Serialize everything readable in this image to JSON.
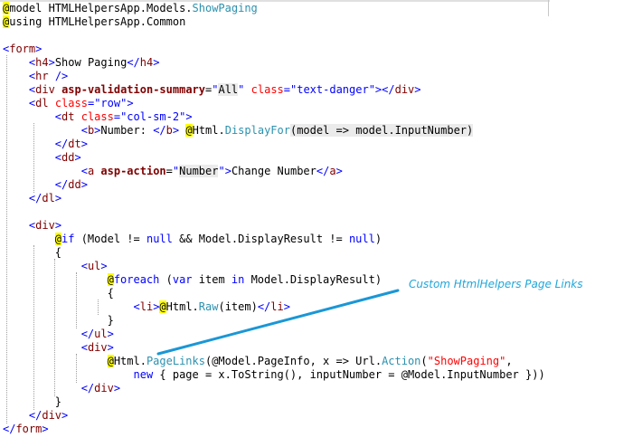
{
  "colors": {
    "keyword_blue": "#0000ff",
    "tag_maroon": "#800000",
    "attr_red": "#ff0000",
    "type_teal": "#2b91af",
    "razor_highlight": "#ffff00",
    "annotation_blue": "#21a6d9"
  },
  "annotation": {
    "text": "Custom HtmlHelpers Page Links"
  },
  "code": [
    [
      [
        "@",
        "hl"
      ],
      [
        "model",
        ""
      ],
      [
        " HTMLHelpersApp.Models.",
        ""
      ],
      [
        "ShowPaging",
        "type"
      ]
    ],
    [
      [
        "@",
        "hl"
      ],
      [
        "using",
        ""
      ],
      [
        " HTMLHelpersApp.Common",
        ""
      ]
    ],
    [],
    [
      [
        "<",
        "kw"
      ],
      [
        "form",
        "tag"
      ],
      [
        ">",
        "kw"
      ]
    ],
    [
      [
        "    ",
        ""
      ],
      [
        "<",
        "kw"
      ],
      [
        "h4",
        "tag"
      ],
      [
        ">",
        "kw"
      ],
      [
        "Show Paging",
        ""
      ],
      [
        "</",
        "kw"
      ],
      [
        "h4",
        "tag"
      ],
      [
        ">",
        "kw"
      ]
    ],
    [
      [
        "    ",
        ""
      ],
      [
        "<",
        "kw"
      ],
      [
        "hr",
        "tag"
      ],
      [
        " />",
        "kw"
      ]
    ],
    [
      [
        "    ",
        ""
      ],
      [
        "<",
        "kw"
      ],
      [
        "div",
        "tag"
      ],
      [
        " ",
        ""
      ],
      [
        "asp-validation-summary",
        "bold"
      ],
      [
        "=",
        ""
      ],
      [
        "\"",
        "kw"
      ],
      [
        "All",
        "bgGray"
      ],
      [
        "\"",
        "kw"
      ],
      [
        " ",
        ""
      ],
      [
        "class",
        "attr"
      ],
      [
        "=",
        "kw"
      ],
      [
        "\"text-danger\"",
        "kw"
      ],
      [
        "></",
        "kw"
      ],
      [
        "div",
        "tag"
      ],
      [
        ">",
        "kw"
      ]
    ],
    [
      [
        "    ",
        ""
      ],
      [
        "<",
        "kw"
      ],
      [
        "dl",
        "tag"
      ],
      [
        " ",
        ""
      ],
      [
        "class",
        "attr"
      ],
      [
        "=",
        "kw"
      ],
      [
        "\"row\"",
        "kw"
      ],
      [
        ">",
        "kw"
      ]
    ],
    [
      [
        "        ",
        ""
      ],
      [
        "<",
        "kw"
      ],
      [
        "dt",
        "tag"
      ],
      [
        " ",
        ""
      ],
      [
        "class",
        "attr"
      ],
      [
        "=",
        "kw"
      ],
      [
        "\"col-sm-2\"",
        "kw"
      ],
      [
        ">",
        "kw"
      ]
    ],
    [
      [
        "            ",
        ""
      ],
      [
        "<",
        "kw"
      ],
      [
        "b",
        "tag"
      ],
      [
        ">",
        "kw"
      ],
      [
        "Number: ",
        ""
      ],
      [
        "</",
        "kw"
      ],
      [
        "b",
        "tag"
      ],
      [
        ">",
        "kw"
      ],
      [
        " ",
        ""
      ],
      [
        "@",
        "hl"
      ],
      [
        "Html.",
        ""
      ],
      [
        "DisplayFor",
        "type"
      ],
      [
        "(model => model.InputNumber)",
        "bgGray"
      ]
    ],
    [
      [
        "        ",
        ""
      ],
      [
        "</",
        "kw"
      ],
      [
        "dt",
        "tag"
      ],
      [
        ">",
        "kw"
      ]
    ],
    [
      [
        "        ",
        ""
      ],
      [
        "<",
        "kw"
      ],
      [
        "dd",
        "tag"
      ],
      [
        ">",
        "kw"
      ]
    ],
    [
      [
        "            ",
        ""
      ],
      [
        "<",
        "kw"
      ],
      [
        "a",
        "tag"
      ],
      [
        " ",
        ""
      ],
      [
        "asp-action",
        "bold"
      ],
      [
        "=",
        ""
      ],
      [
        "\"",
        "kw"
      ],
      [
        "Number",
        "bgGray"
      ],
      [
        "\"",
        "kw"
      ],
      [
        ">",
        "kw"
      ],
      [
        "Change Number",
        ""
      ],
      [
        "</",
        "kw"
      ],
      [
        "a",
        "tag"
      ],
      [
        ">",
        "kw"
      ]
    ],
    [
      [
        "        ",
        ""
      ],
      [
        "</",
        "kw"
      ],
      [
        "dd",
        "tag"
      ],
      [
        ">",
        "kw"
      ]
    ],
    [
      [
        "    ",
        ""
      ],
      [
        "</",
        "kw"
      ],
      [
        "dl",
        "tag"
      ],
      [
        ">",
        "kw"
      ]
    ],
    [],
    [
      [
        "    ",
        ""
      ],
      [
        "<",
        "kw"
      ],
      [
        "div",
        "tag"
      ],
      [
        ">",
        "kw"
      ]
    ],
    [
      [
        "        ",
        ""
      ],
      [
        "@",
        "hl"
      ],
      [
        "if",
        "hlkw"
      ],
      [
        " (Model != ",
        ""
      ],
      [
        "null",
        "kw"
      ],
      [
        " && Model.DisplayResult != ",
        ""
      ],
      [
        "null",
        "kw"
      ],
      [
        ")",
        ""
      ]
    ],
    [
      [
        "        {",
        ""
      ]
    ],
    [
      [
        "            ",
        ""
      ],
      [
        "<",
        "kw"
      ],
      [
        "ul",
        "tag"
      ],
      [
        ">",
        "kw"
      ]
    ],
    [
      [
        "                ",
        ""
      ],
      [
        "@",
        "hl"
      ],
      [
        "foreach",
        "hlkw"
      ],
      [
        " (",
        ""
      ],
      [
        "var",
        "kw"
      ],
      [
        " item ",
        ""
      ],
      [
        "in",
        "kw"
      ],
      [
        " Model.DisplayResult)",
        ""
      ]
    ],
    [
      [
        "                {",
        ""
      ]
    ],
    [
      [
        "                    ",
        ""
      ],
      [
        "<",
        "kw"
      ],
      [
        "li",
        "tag"
      ],
      [
        ">",
        "kw"
      ],
      [
        "@",
        "hl"
      ],
      [
        "Html.",
        ""
      ],
      [
        "Raw",
        "type"
      ],
      [
        "(item)",
        ""
      ],
      [
        "</",
        "kw"
      ],
      [
        "li",
        "tag"
      ],
      [
        ">",
        "kw"
      ]
    ],
    [
      [
        "                }",
        ""
      ]
    ],
    [
      [
        "            ",
        ""
      ],
      [
        "</",
        "kw"
      ],
      [
        "ul",
        "tag"
      ],
      [
        ">",
        "kw"
      ]
    ],
    [
      [
        "            ",
        ""
      ],
      [
        "<",
        "kw"
      ],
      [
        "div",
        "tag"
      ],
      [
        ">",
        "kw"
      ]
    ],
    [
      [
        "                ",
        ""
      ],
      [
        "@",
        "hl"
      ],
      [
        "Html.",
        ""
      ],
      [
        "PageLinks",
        "type"
      ],
      [
        "(@Model.PageInfo, x => Url.",
        ""
      ],
      [
        "Action",
        "type"
      ],
      [
        "(",
        ""
      ],
      [
        "\"ShowPaging\"",
        "attr"
      ],
      [
        ",",
        ""
      ]
    ],
    [
      [
        "                    ",
        ""
      ],
      [
        "new",
        "kw"
      ],
      [
        " { page = x.ToString(), inputNumber = @Model.InputNumber }))",
        ""
      ]
    ],
    [
      [
        "            ",
        ""
      ],
      [
        "</",
        "kw"
      ],
      [
        "div",
        "tag"
      ],
      [
        ">",
        "kw"
      ]
    ],
    [
      [
        "        }",
        ""
      ]
    ],
    [
      [
        "    ",
        ""
      ],
      [
        "</",
        "kw"
      ],
      [
        "div",
        "tag"
      ],
      [
        ">",
        "kw"
      ]
    ],
    [
      [
        "</",
        "kw"
      ],
      [
        "form",
        "tag"
      ],
      [
        ">",
        "kw"
      ]
    ]
  ]
}
